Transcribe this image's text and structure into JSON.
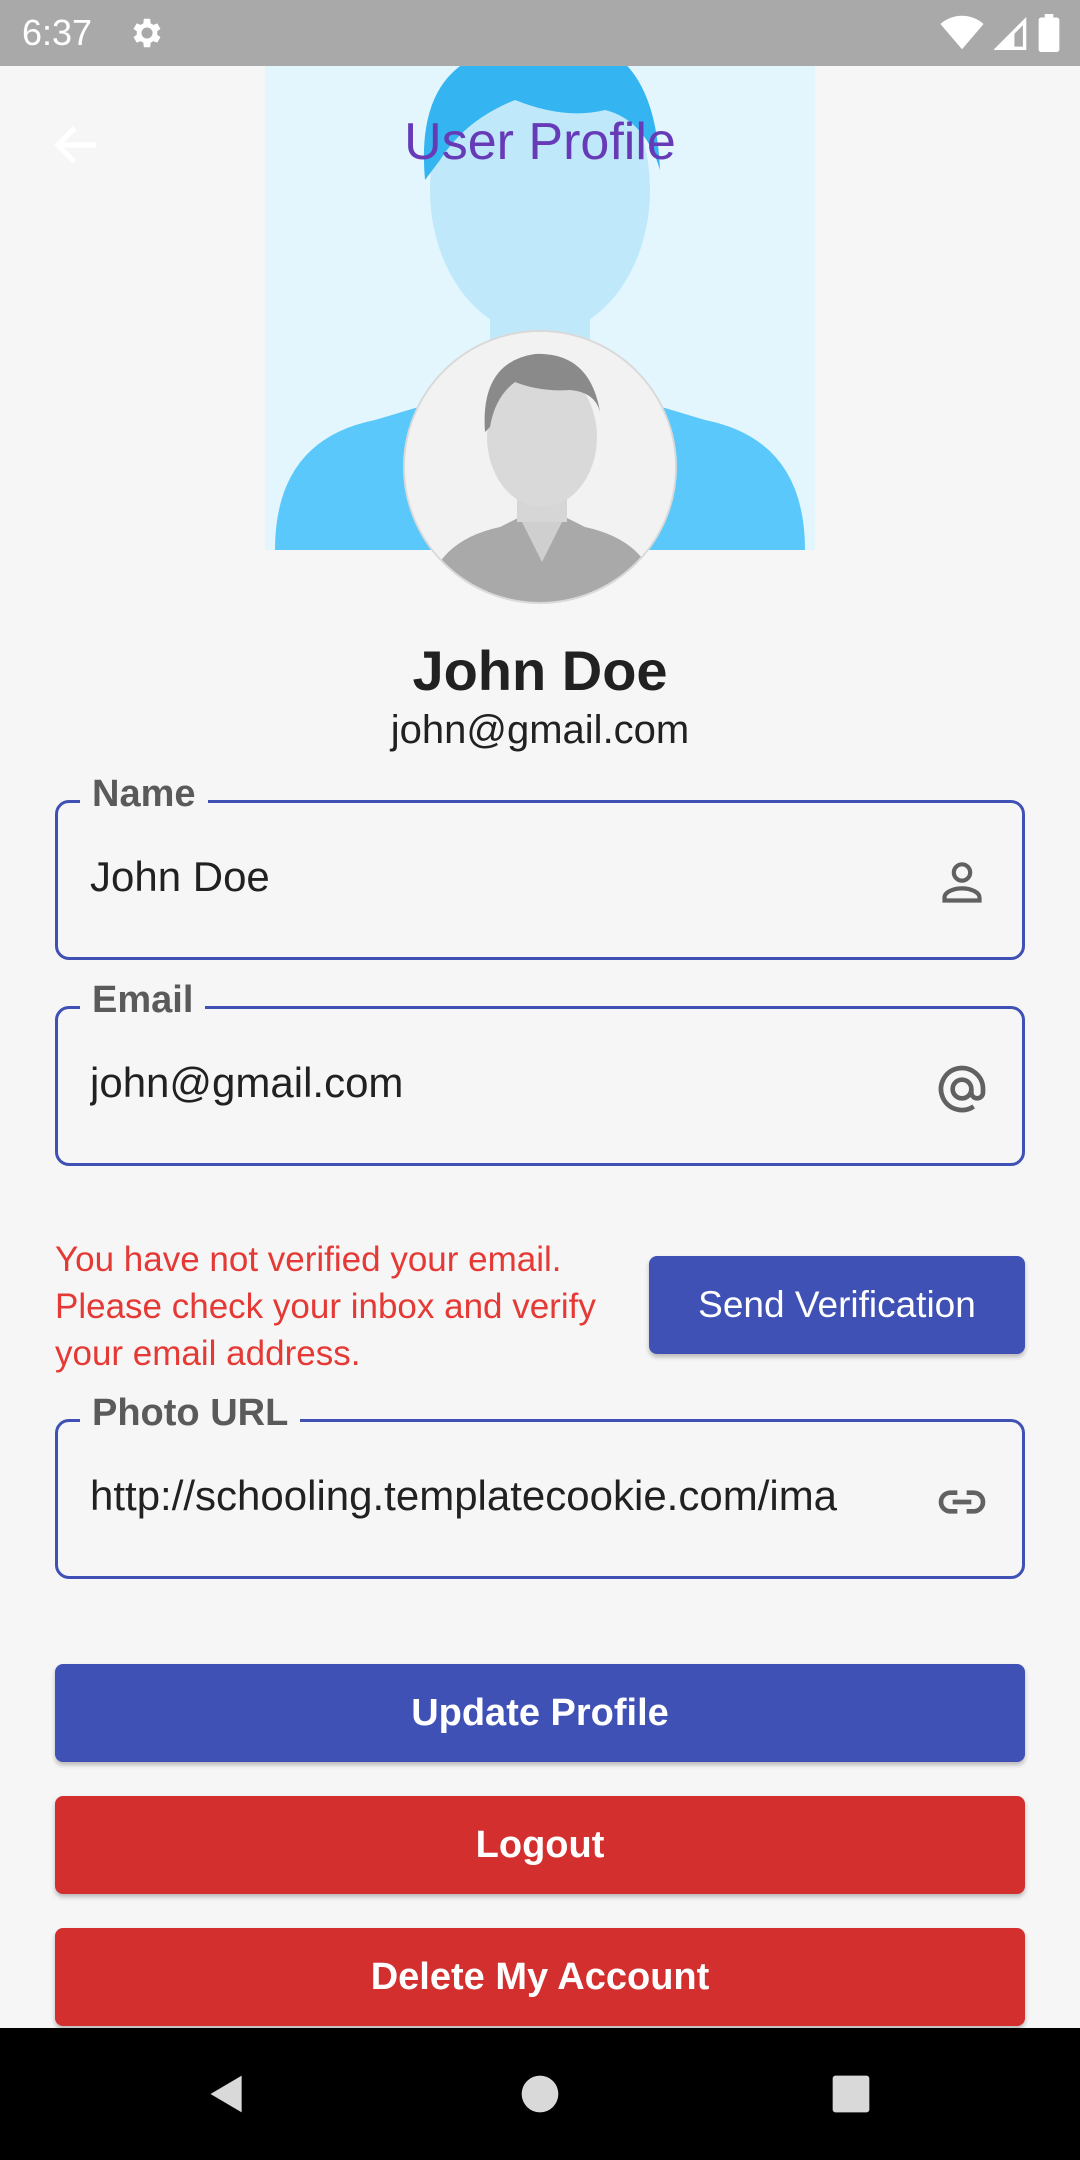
{
  "status_bar": {
    "time": "6:37",
    "settings_icon": "gear-icon",
    "wifi_icon": "wifi-icon",
    "signal_icon": "signal-icon",
    "battery_icon": "battery-icon"
  },
  "app_bar": {
    "title": "User Profile",
    "back_icon": "arrow-left-icon",
    "title_color": "#673ab7"
  },
  "profile": {
    "name": "John Doe",
    "email": "john@gmail.com"
  },
  "form": {
    "name": {
      "label": "Name",
      "value": "John Doe",
      "icon": "person-icon"
    },
    "email": {
      "label": "Email",
      "value": "john@gmail.com",
      "icon": "at-sign-icon"
    },
    "photo_url": {
      "label": "Photo URL",
      "value": "http://schooling.templatecookie.com/ima",
      "icon": "link-icon"
    }
  },
  "verification": {
    "message": "You have not verified your email. Please check your inbox and verify your email address.",
    "button_label": "Send Verification",
    "message_color": "#e53935"
  },
  "actions": {
    "update_label": "Update Profile",
    "logout_label": "Logout",
    "delete_label": "Delete My Account"
  },
  "colors": {
    "primary": "#3f51b5",
    "danger": "#d32f2f",
    "background": "#f6f6f6"
  },
  "nav_bar": {
    "back_icon": "triangle-back-icon",
    "home_icon": "circle-home-icon",
    "recents_icon": "square-recents-icon"
  }
}
